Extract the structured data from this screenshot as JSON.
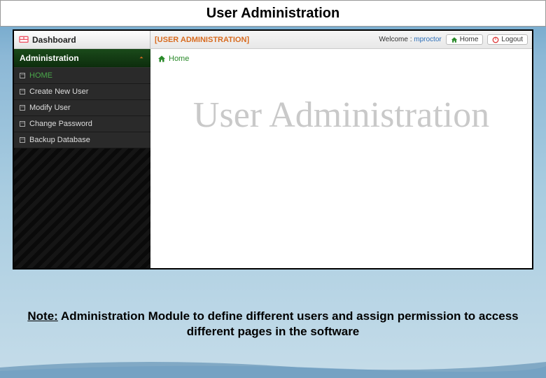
{
  "slide": {
    "title": "User Administration"
  },
  "app": {
    "dashboard_label": "Dashboard",
    "section_name": "[USER ADMINISTRATION]",
    "welcome_prefix": "Welcome :",
    "welcome_user": "mproctor",
    "home_btn": "Home",
    "logout_btn": "Logout"
  },
  "sidebar": {
    "header": "Administration",
    "items": [
      {
        "label": "HOME"
      },
      {
        "label": "Create New User"
      },
      {
        "label": "Modify User"
      },
      {
        "label": "Change Password"
      },
      {
        "label": "Backup Database"
      }
    ]
  },
  "breadcrumb": {
    "home": "Home"
  },
  "watermark": {
    "text": "User Administration"
  },
  "note": {
    "prefix": "Note:",
    "body": " Administration Module to define different users and assign permission to access different pages in the software"
  }
}
